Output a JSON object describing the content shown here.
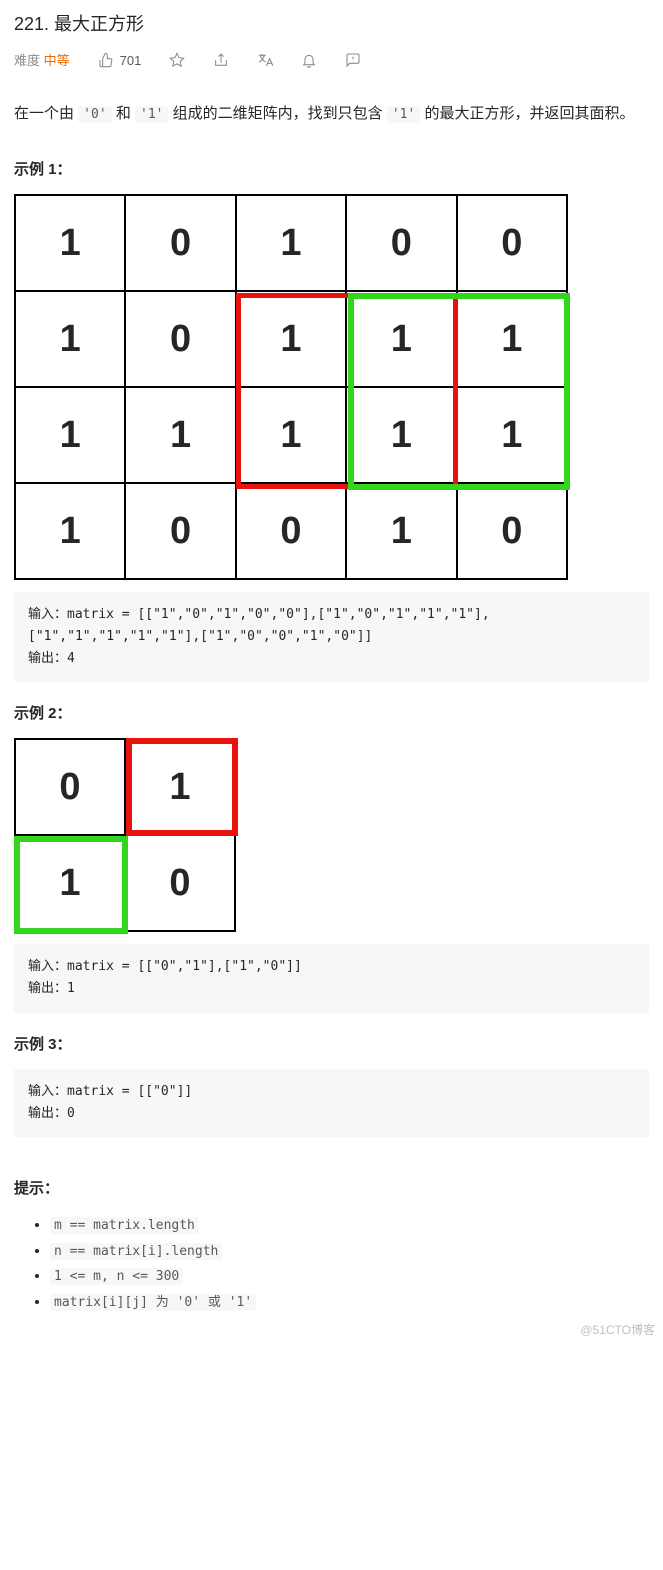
{
  "title": "221. 最大正方形",
  "meta": {
    "diff_label": "难度",
    "diff_value": "中等",
    "likes": "701"
  },
  "desc_parts": {
    "p1": "在一个由 ",
    "c1": "'0'",
    "p2": " 和 ",
    "c2": "'1'",
    "p3": " 组成的二维矩阵内，找到只包含 ",
    "c3": "'1'",
    "p4": " 的最大正方形，并返回其面积。"
  },
  "examples": [
    {
      "head": "示例 1：",
      "matrix": [
        [
          "1",
          "0",
          "1",
          "0",
          "0"
        ],
        [
          "1",
          "0",
          "1",
          "1",
          "1"
        ],
        [
          "1",
          "1",
          "1",
          "1",
          "1"
        ],
        [
          "1",
          "0",
          "0",
          "1",
          "0"
        ]
      ],
      "input_label": "输入：",
      "input_val": "matrix = [[\"1\",\"0\",\"1\",\"0\",\"0\"],[\"1\",\"0\",\"1\",\"1\",\"1\"],[\"1\",\"1\",\"1\",\"1\",\"1\"],[\"1\",\"0\",\"0\",\"1\",\"0\"]]",
      "output_label": "输出：",
      "output_val": "4"
    },
    {
      "head": "示例 2：",
      "matrix": [
        [
          "0",
          "1"
        ],
        [
          "1",
          "0"
        ]
      ],
      "input_label": "输入：",
      "input_val": "matrix = [[\"0\",\"1\"],[\"1\",\"0\"]]",
      "output_label": "输出：",
      "output_val": "1"
    },
    {
      "head": "示例 3：",
      "input_label": "输入：",
      "input_val": "matrix = [[\"0\"]]",
      "output_label": "输出：",
      "output_val": "0"
    }
  ],
  "hints_head": "提示：",
  "hints": [
    "m == matrix.length",
    "n == matrix[i].length",
    "1 <= m, n <= 300",
    "matrix[i][j] 为 '0' 或 '1'"
  ],
  "watermark": "@51CTO博客"
}
